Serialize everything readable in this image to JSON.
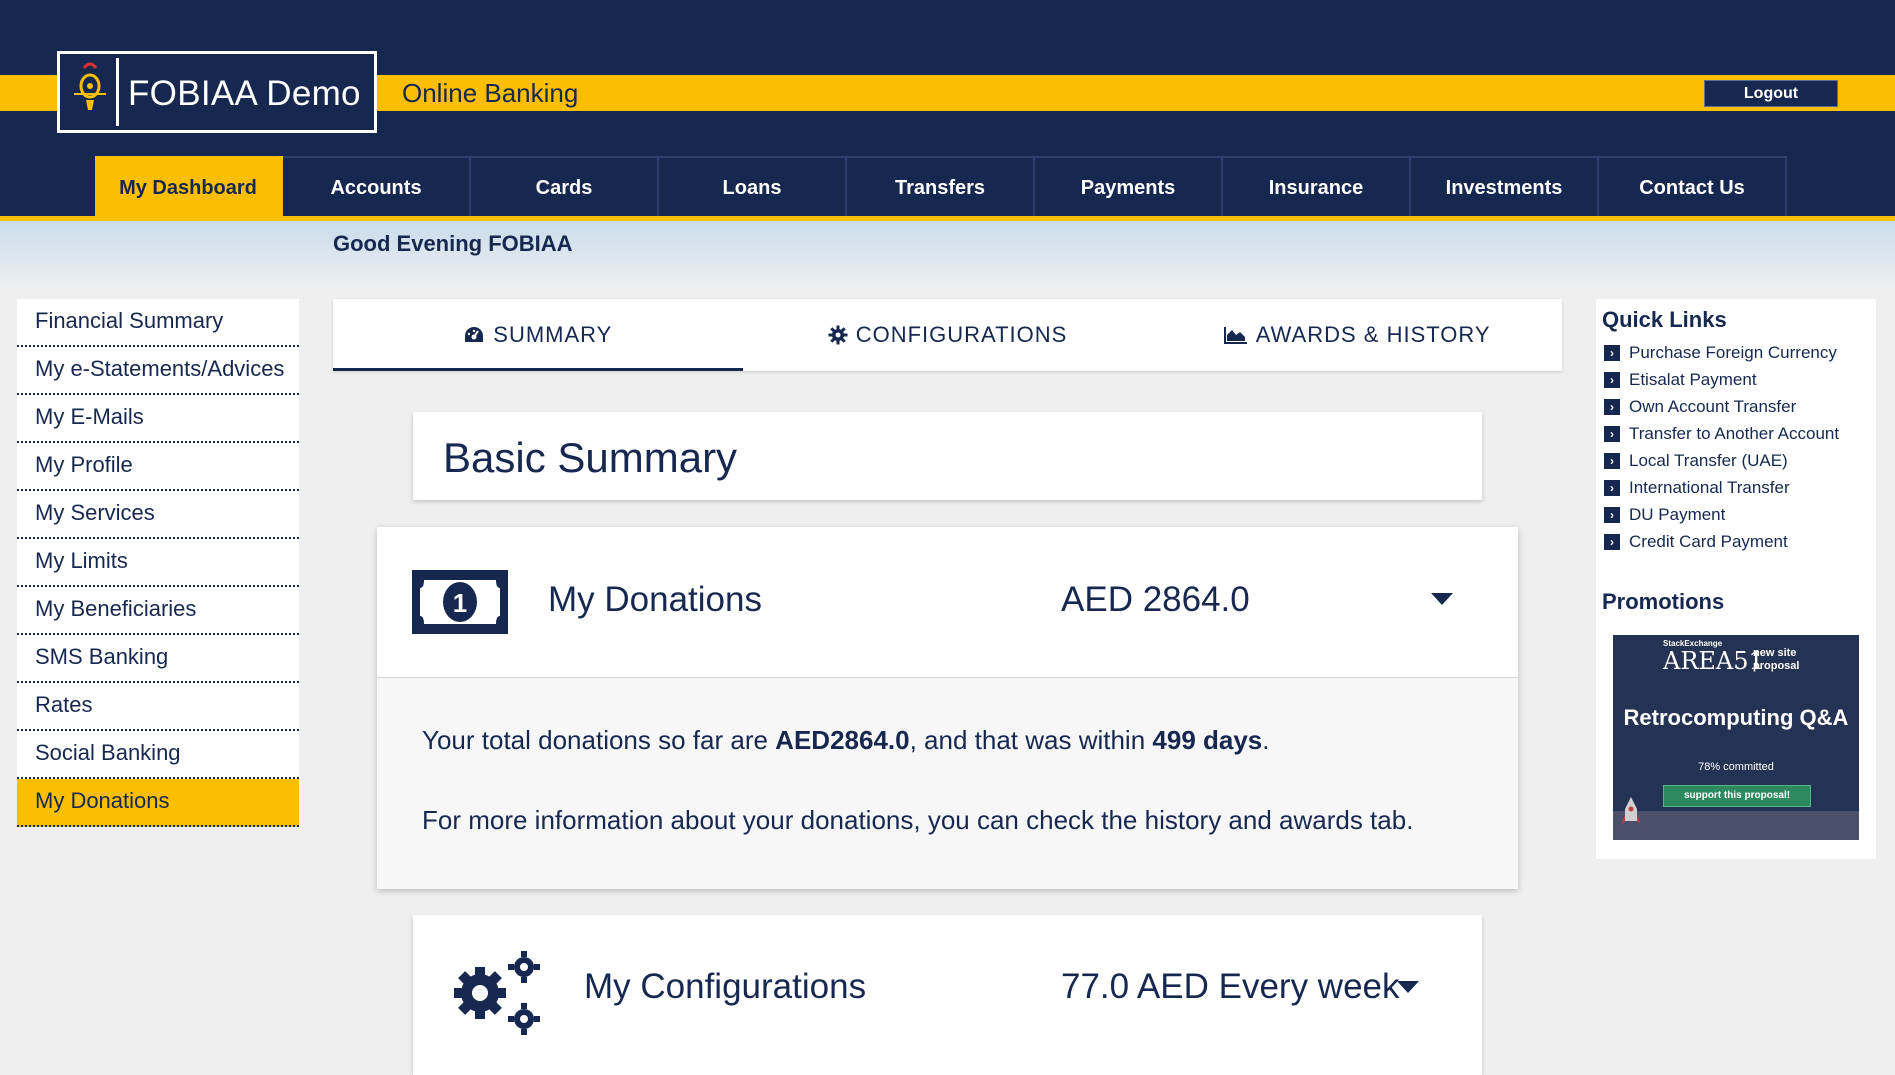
{
  "brand": {
    "logo_text": "FOBIAA Demo",
    "tagline": "Online Banking",
    "logout_label": "Logout"
  },
  "nav": {
    "items": [
      "My Dashboard",
      "Accounts",
      "Cards",
      "Loans",
      "Transfers",
      "Payments",
      "Insurance",
      "Investments",
      "Contact Us"
    ],
    "active": "My Dashboard"
  },
  "greeting": "Good Evening FOBIAA",
  "left_menu": {
    "items": [
      "Financial Summary",
      "My e-Statements/Advices",
      "My E-Mails",
      "My Profile",
      "My Services",
      "My Limits",
      "My Beneficiaries",
      "SMS Banking",
      "Rates",
      "Social Banking",
      "My Donations"
    ],
    "active": "My Donations"
  },
  "tabs": {
    "summary": "SUMMARY",
    "configurations": "CONFIGURATIONS",
    "awards_history": "AWARDS & HISTORY",
    "active": "SUMMARY"
  },
  "basic_summary": {
    "title": "Basic Summary"
  },
  "donations": {
    "title": "My Donations",
    "amount": "AED 2864.0",
    "text_prefix": "Your total donations so far are ",
    "text_amount": "AED2864.0",
    "text_mid": ", and that was within ",
    "text_days": "499 days",
    "text_suffix": ".",
    "more_info": "For more information about your donations, you can check the history and awards tab."
  },
  "configurations": {
    "title": "My Configurations",
    "value": "77.0 AED Every week"
  },
  "quick_links": {
    "title": "Quick Links",
    "items": [
      "Purchase Foreign Currency",
      "Etisalat Payment",
      "Own Account Transfer",
      "Transfer to Another Account",
      "Local Transfer (UAE)",
      "International Transfer",
      "DU Payment",
      "Credit Card Payment"
    ]
  },
  "promotions": {
    "title": "Promotions",
    "banner": {
      "top_small": "StackExchange",
      "area": "AREA51",
      "new_site": "new site proposal",
      "headline": "Retrocomputing Q&A",
      "committed": "78% committed",
      "button": "support this proposal!"
    }
  },
  "colors": {
    "navy": "#16284f",
    "yellow": "#fbbe00",
    "background": "#efefef"
  }
}
